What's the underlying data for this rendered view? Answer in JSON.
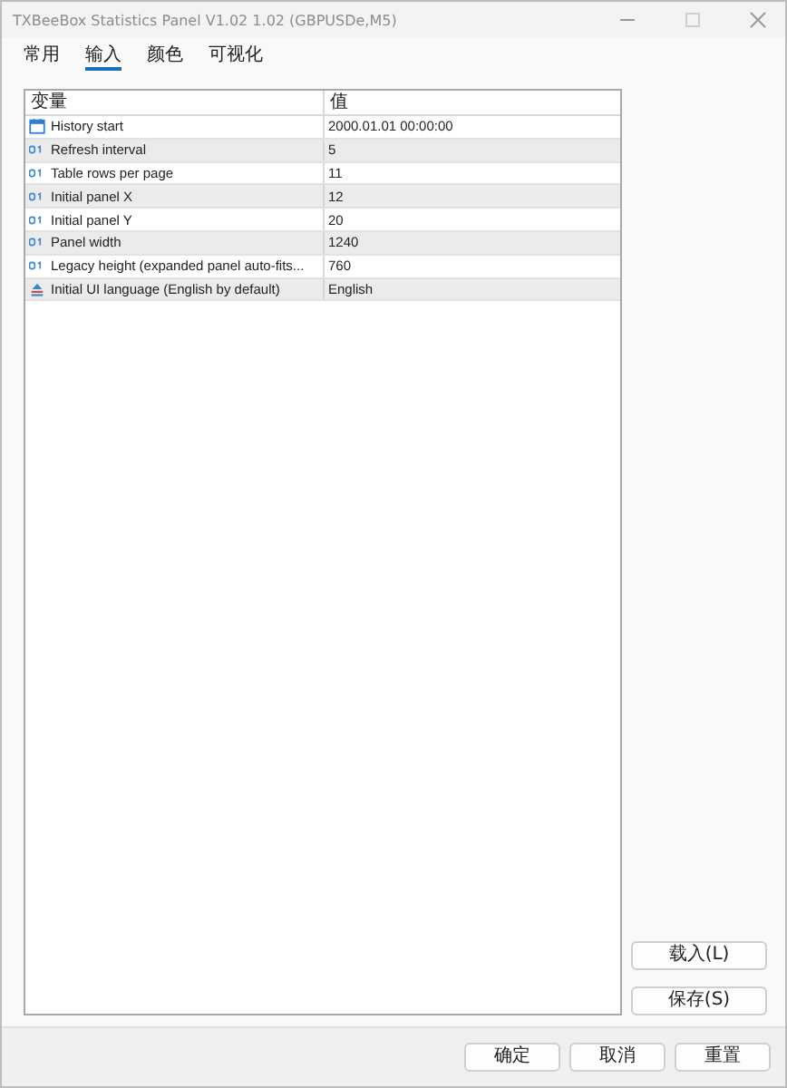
{
  "window": {
    "title": "TXBeeBox Statistics Panel V1.02 1.02 (GBPUSDe,M5)"
  },
  "tabs": [
    {
      "label": "常用",
      "selected": false
    },
    {
      "label": "输入",
      "selected": true
    },
    {
      "label": "颜色",
      "selected": false
    },
    {
      "label": "可视化",
      "selected": false
    }
  ],
  "table": {
    "columns": [
      "变量",
      "值"
    ],
    "rows": [
      {
        "kind": "date",
        "name": "History start",
        "value": "2000.01.01 00:00:00"
      },
      {
        "kind": "int",
        "name": "Refresh interval",
        "value": "5"
      },
      {
        "kind": "int",
        "name": "Table rows per page",
        "value": "11"
      },
      {
        "kind": "int",
        "name": "Initial panel X",
        "value": "12"
      },
      {
        "kind": "int",
        "name": "Initial panel Y",
        "value": "20"
      },
      {
        "kind": "int",
        "name": "Panel width",
        "value": "1240"
      },
      {
        "kind": "int",
        "name": "Legacy height (expanded panel auto-fits...",
        "value": "760"
      },
      {
        "kind": "enum",
        "name": "Initial UI language (English by default)",
        "value": "English"
      }
    ]
  },
  "side_buttons": [
    "载入(L)",
    "保存(S)"
  ],
  "footer_buttons": [
    "确定",
    "取消",
    "重置"
  ]
}
